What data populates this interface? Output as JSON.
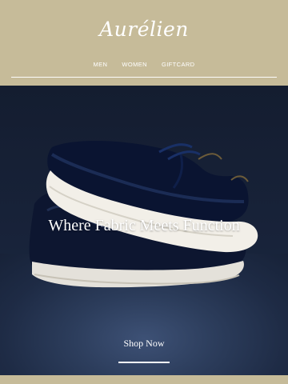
{
  "brand": {
    "logo_text": "Aurélien"
  },
  "nav": {
    "items": [
      {
        "label": "MEN"
      },
      {
        "label": "WOMEN"
      },
      {
        "label": "GIFTCARD"
      }
    ]
  },
  "hero": {
    "headline": "Where Fabric Meets Function",
    "cta_label": "Shop Now"
  },
  "colors": {
    "background": "#c6bb99",
    "hero_background": "#18233a",
    "text": "#ffffff"
  }
}
